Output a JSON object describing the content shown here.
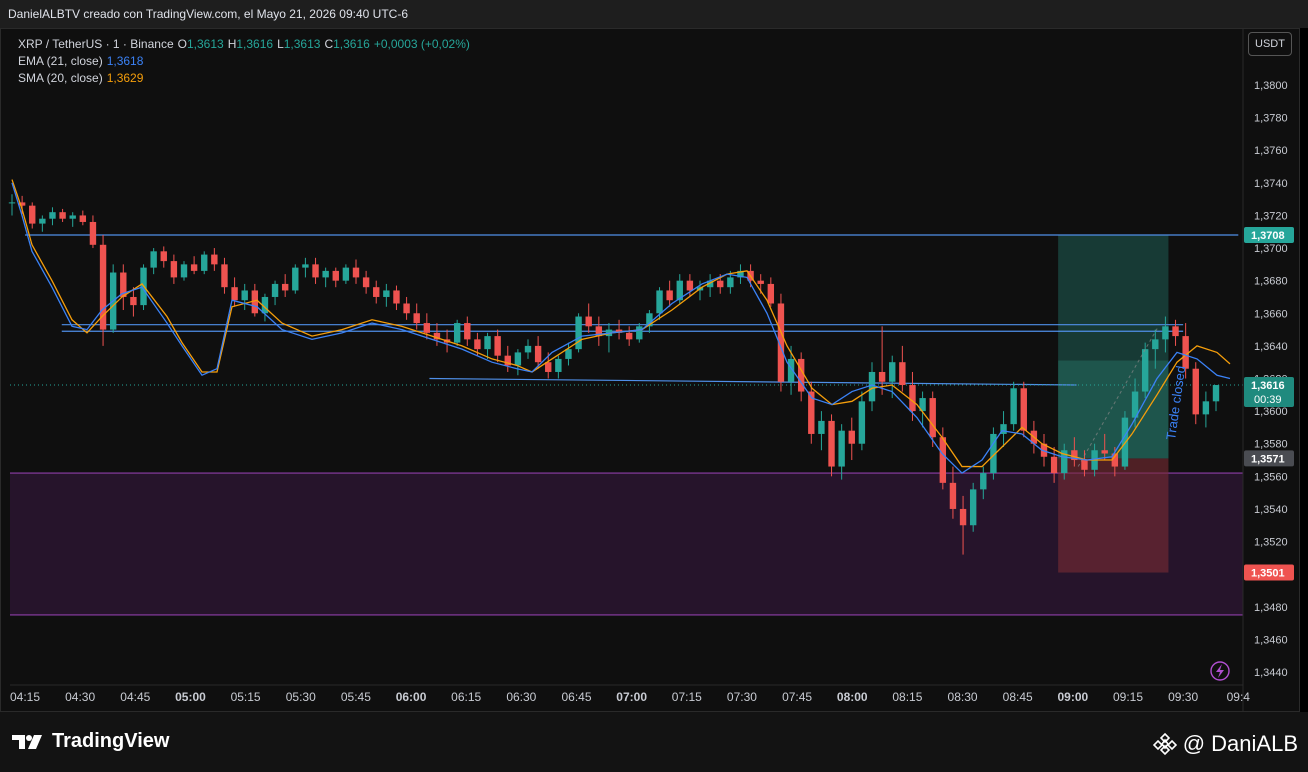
{
  "header": {
    "caption": "DanielALBTV creado con TradingView.com, el Mayo 21, 2026 09:40 UTC-6"
  },
  "legend": {
    "symbol": "XRP / TetherUS · 1 · Binance",
    "o_label": "O",
    "o_value": "1,3613",
    "h_label": "H",
    "h_value": "1,3616",
    "l_label": "L",
    "l_value": "1,3613",
    "c_label": "C",
    "c_value": "1,3616",
    "change": "+0,0003 (+0,02%)",
    "ema_label": "EMA (21, close)",
    "ema_value": "1,3618",
    "sma_label": "SMA (20, close)",
    "sma_value": "1,3629"
  },
  "currency_button": "USDT",
  "annotation": "Trade closed",
  "footer": {
    "brand": "TradingView",
    "author": "@ DaniALB"
  },
  "colors": {
    "up": "#26a69a",
    "down": "#ef5350",
    "ema": "#3b82f6",
    "sma": "#f59e0b",
    "level": "#4f8fe8",
    "zone": "#8e3ea8",
    "tp": "#1f5f55",
    "sl": "#7a2b33"
  },
  "chart_data": {
    "type": "candlestick",
    "x_ticks": [
      "04:15",
      "04:30",
      "04:45",
      "05:00",
      "05:15",
      "05:30",
      "05:45",
      "06:00",
      "06:15",
      "06:30",
      "06:45",
      "07:00",
      "07:15",
      "07:30",
      "07:45",
      "08:00",
      "08:15",
      "08:30",
      "08:45",
      "09:00",
      "09:15",
      "09:30",
      "09:4"
    ],
    "x_ticks_bold": [
      "05:00",
      "06:00",
      "07:00",
      "08:00",
      "09:00"
    ],
    "y_ticks": [
      "1,3800",
      "1,3780",
      "1,3760",
      "1,3740",
      "1,3720",
      "1,3700",
      "1,3680",
      "1,3660",
      "1,3640",
      "1,3620",
      "1,3600",
      "1,3580",
      "1,3560",
      "1,3540",
      "1,3520",
      "1,3480",
      "1,3460",
      "1,3440"
    ],
    "y_range": [
      1.3435,
      1.3825
    ],
    "price_labels": [
      {
        "text": "1,3708",
        "value": 1.3708,
        "kind": "tp"
      },
      {
        "text": "1,3616",
        "sub": "00:39",
        "value": 1.3616,
        "kind": "last"
      },
      {
        "text": "1,3571",
        "value": 1.3571,
        "kind": "entry"
      },
      {
        "text": "1,3501",
        "value": 1.3501,
        "kind": "sl"
      }
    ],
    "horizontal_levels": [
      {
        "value": 1.3708,
        "x_from": "04:15",
        "x_to": "09:4"
      },
      {
        "value": 1.3653,
        "x_from": "04:25",
        "x_to": "09:30"
      },
      {
        "value": 1.3649,
        "x_from": "04:25",
        "x_to": "09:30"
      }
    ],
    "trend_line": {
      "from": {
        "x": "06:05",
        "y": 1.362
      },
      "to": {
        "x": "09:01",
        "y": 1.3616
      }
    },
    "zone": {
      "top": 1.3562,
      "bottom": 1.3475
    },
    "position": {
      "x_from": "08:56",
      "x_to": "09:26",
      "entry": 1.3571,
      "target": 1.3708,
      "stop": 1.3501
    },
    "candles": [
      [
        1.3728,
        1.3733,
        1.372,
        1.3728
      ],
      [
        1.3728,
        1.3732,
        1.3721,
        1.3726
      ],
      [
        1.3726,
        1.3728,
        1.3712,
        1.3715
      ],
      [
        1.3715,
        1.372,
        1.371,
        1.3718
      ],
      [
        1.3718,
        1.3725,
        1.3714,
        1.3722
      ],
      [
        1.3722,
        1.3724,
        1.3716,
        1.3718
      ],
      [
        1.3718,
        1.3722,
        1.3713,
        1.372
      ],
      [
        1.372,
        1.3723,
        1.3714,
        1.3716
      ],
      [
        1.3716,
        1.372,
        1.37,
        1.3702
      ],
      [
        1.3702,
        1.3708,
        1.364,
        1.365
      ],
      [
        1.365,
        1.369,
        1.3648,
        1.3685
      ],
      [
        1.3685,
        1.369,
        1.3662,
        1.367
      ],
      [
        1.367,
        1.3676,
        1.3658,
        1.3665
      ],
      [
        1.3665,
        1.369,
        1.3662,
        1.3688
      ],
      [
        1.3688,
        1.37,
        1.3684,
        1.3698
      ],
      [
        1.3698,
        1.3701,
        1.3688,
        1.3692
      ],
      [
        1.3692,
        1.3696,
        1.3678,
        1.3682
      ],
      [
        1.3682,
        1.3692,
        1.368,
        1.369
      ],
      [
        1.369,
        1.3695,
        1.3684,
        1.3686
      ],
      [
        1.3686,
        1.3698,
        1.3684,
        1.3696
      ],
      [
        1.3696,
        1.37,
        1.3686,
        1.369
      ],
      [
        1.369,
        1.3694,
        1.3672,
        1.3676
      ],
      [
        1.3676,
        1.3682,
        1.3664,
        1.3668
      ],
      [
        1.3668,
        1.3678,
        1.3662,
        1.3674
      ],
      [
        1.3674,
        1.3678,
        1.3658,
        1.366
      ],
      [
        1.366,
        1.3672,
        1.3655,
        1.367
      ],
      [
        1.367,
        1.368,
        1.3665,
        1.3678
      ],
      [
        1.3678,
        1.3684,
        1.367,
        1.3674
      ],
      [
        1.3674,
        1.369,
        1.3672,
        1.3688
      ],
      [
        1.3688,
        1.3694,
        1.3682,
        1.369
      ],
      [
        1.369,
        1.3694,
        1.3678,
        1.3682
      ],
      [
        1.3682,
        1.3688,
        1.3676,
        1.3686
      ],
      [
        1.3686,
        1.3688,
        1.3676,
        1.368
      ],
      [
        1.368,
        1.369,
        1.3678,
        1.3688
      ],
      [
        1.3688,
        1.3693,
        1.3678,
        1.3682
      ],
      [
        1.3682,
        1.3686,
        1.3672,
        1.3676
      ],
      [
        1.3676,
        1.368,
        1.3666,
        1.367
      ],
      [
        1.367,
        1.3678,
        1.3664,
        1.3674
      ],
      [
        1.3674,
        1.3677,
        1.3662,
        1.3666
      ],
      [
        1.3666,
        1.367,
        1.3656,
        1.366
      ],
      [
        1.366,
        1.3666,
        1.365,
        1.3654
      ],
      [
        1.3654,
        1.366,
        1.3644,
        1.3648
      ],
      [
        1.3648,
        1.3654,
        1.364,
        1.3644
      ],
      [
        1.3644,
        1.365,
        1.3636,
        1.3642
      ],
      [
        1.3642,
        1.3656,
        1.364,
        1.3654
      ],
      [
        1.3654,
        1.3658,
        1.364,
        1.3644
      ],
      [
        1.3644,
        1.3648,
        1.3634,
        1.3638
      ],
      [
        1.3638,
        1.3648,
        1.3632,
        1.3646
      ],
      [
        1.3646,
        1.365,
        1.363,
        1.3634
      ],
      [
        1.3634,
        1.364,
        1.3624,
        1.3628
      ],
      [
        1.3628,
        1.3638,
        1.3622,
        1.3636
      ],
      [
        1.3636,
        1.3644,
        1.3632,
        1.364
      ],
      [
        1.364,
        1.3646,
        1.3626,
        1.363
      ],
      [
        1.363,
        1.3636,
        1.362,
        1.3624
      ],
      [
        1.3624,
        1.3634,
        1.362,
        1.3632
      ],
      [
        1.3632,
        1.3642,
        1.3628,
        1.3638
      ],
      [
        1.3638,
        1.366,
        1.3636,
        1.3658
      ],
      [
        1.3658,
        1.3666,
        1.3648,
        1.3652
      ],
      [
        1.3652,
        1.3658,
        1.364,
        1.3646
      ],
      [
        1.3646,
        1.3654,
        1.3636,
        1.365
      ],
      [
        1.365,
        1.3656,
        1.3644,
        1.3648
      ],
      [
        1.3648,
        1.3652,
        1.364,
        1.3644
      ],
      [
        1.3644,
        1.3654,
        1.3642,
        1.3652
      ],
      [
        1.3652,
        1.3662,
        1.3648,
        1.366
      ],
      [
        1.366,
        1.3676,
        1.3656,
        1.3674
      ],
      [
        1.3674,
        1.368,
        1.3664,
        1.3668
      ],
      [
        1.3668,
        1.3684,
        1.3666,
        1.368
      ],
      [
        1.368,
        1.3684,
        1.367,
        1.3674
      ],
      [
        1.3674,
        1.368,
        1.3668,
        1.3676
      ],
      [
        1.3676,
        1.3684,
        1.367,
        1.368
      ],
      [
        1.368,
        1.3684,
        1.3672,
        1.3676
      ],
      [
        1.3676,
        1.3686,
        1.3672,
        1.3682
      ],
      [
        1.3682,
        1.369,
        1.3678,
        1.3686
      ],
      [
        1.3686,
        1.369,
        1.3676,
        1.368
      ],
      [
        1.368,
        1.3684,
        1.3672,
        1.3678
      ],
      [
        1.3678,
        1.3682,
        1.3664,
        1.3666
      ],
      [
        1.3666,
        1.3672,
        1.3612,
        1.3618
      ],
      [
        1.3618,
        1.364,
        1.361,
        1.3632
      ],
      [
        1.3632,
        1.3636,
        1.3606,
        1.3612
      ],
      [
        1.3612,
        1.3618,
        1.358,
        1.3586
      ],
      [
        1.3586,
        1.36,
        1.3576,
        1.3594
      ],
      [
        1.3594,
        1.3598,
        1.356,
        1.3566
      ],
      [
        1.3566,
        1.3592,
        1.3558,
        1.3588
      ],
      [
        1.3588,
        1.3596,
        1.357,
        1.358
      ],
      [
        1.358,
        1.3612,
        1.3576,
        1.3606
      ],
      [
        1.3606,
        1.363,
        1.36,
        1.3624
      ],
      [
        1.3624,
        1.3652,
        1.361,
        1.3618
      ],
      [
        1.3618,
        1.3634,
        1.3608,
        1.363
      ],
      [
        1.363,
        1.364,
        1.3612,
        1.3616
      ],
      [
        1.3616,
        1.3624,
        1.3594,
        1.36
      ],
      [
        1.36,
        1.3612,
        1.359,
        1.3608
      ],
      [
        1.3608,
        1.3612,
        1.3578,
        1.3584
      ],
      [
        1.3584,
        1.359,
        1.3552,
        1.3556
      ],
      [
        1.3556,
        1.3566,
        1.3534,
        1.354
      ],
      [
        1.354,
        1.3548,
        1.3512,
        1.353
      ],
      [
        1.353,
        1.3556,
        1.3526,
        1.3552
      ],
      [
        1.3552,
        1.3566,
        1.3546,
        1.3562
      ],
      [
        1.3562,
        1.359,
        1.3558,
        1.3586
      ],
      [
        1.3586,
        1.36,
        1.3578,
        1.3592
      ],
      [
        1.3592,
        1.3618,
        1.3588,
        1.3614
      ],
      [
        1.3614,
        1.3618,
        1.3584,
        1.3588
      ],
      [
        1.3588,
        1.3594,
        1.3574,
        1.358
      ],
      [
        1.358,
        1.3586,
        1.3566,
        1.3572
      ],
      [
        1.3572,
        1.3578,
        1.3556,
        1.3562
      ],
      [
        1.3562,
        1.358,
        1.3558,
        1.3576
      ],
      [
        1.3576,
        1.3584,
        1.3566,
        1.357
      ],
      [
        1.357,
        1.3576,
        1.356,
        1.3564
      ],
      [
        1.3564,
        1.358,
        1.356,
        1.3576
      ],
      [
        1.3576,
        1.3586,
        1.357,
        1.3574
      ],
      [
        1.3574,
        1.3578,
        1.356,
        1.3566
      ],
      [
        1.3566,
        1.36,
        1.3564,
        1.3596
      ],
      [
        1.3596,
        1.362,
        1.359,
        1.3612
      ],
      [
        1.3612,
        1.3642,
        1.3608,
        1.3638
      ],
      [
        1.3638,
        1.365,
        1.3626,
        1.3644
      ],
      [
        1.3644,
        1.3658,
        1.3636,
        1.3652
      ],
      [
        1.3652,
        1.3656,
        1.364,
        1.3646
      ],
      [
        1.3646,
        1.3654,
        1.362,
        1.3626
      ],
      [
        1.3626,
        1.363,
        1.3592,
        1.3598
      ],
      [
        1.3598,
        1.3612,
        1.359,
        1.3606
      ],
      [
        1.3606,
        1.3616,
        1.36,
        1.3616
      ]
    ],
    "ema_21": [
      [
        0,
        1.374
      ],
      [
        10,
        1.372
      ],
      [
        20,
        1.3698
      ],
      [
        40,
        1.3676
      ],
      [
        60,
        1.3652
      ],
      [
        75,
        1.365
      ],
      [
        90,
        1.3662
      ],
      [
        110,
        1.3672
      ],
      [
        130,
        1.3676
      ],
      [
        155,
        1.3654
      ],
      [
        170,
        1.364
      ],
      [
        190,
        1.3622
      ],
      [
        205,
        1.3626
      ],
      [
        220,
        1.3668
      ],
      [
        245,
        1.3664
      ],
      [
        270,
        1.365
      ],
      [
        300,
        1.3644
      ],
      [
        330,
        1.3648
      ],
      [
        360,
        1.3654
      ],
      [
        390,
        1.365
      ],
      [
        420,
        1.3644
      ],
      [
        450,
        1.3638
      ],
      [
        480,
        1.363
      ],
      [
        505,
        1.3626
      ],
      [
        520,
        1.3624
      ],
      [
        540,
        1.3636
      ],
      [
        570,
        1.3646
      ],
      [
        600,
        1.3648
      ],
      [
        630,
        1.365
      ],
      [
        660,
        1.3666
      ],
      [
        690,
        1.3678
      ],
      [
        715,
        1.3684
      ],
      [
        735,
        1.3682
      ],
      [
        755,
        1.366
      ],
      [
        775,
        1.363
      ],
      [
        800,
        1.3608
      ],
      [
        820,
        1.3604
      ],
      [
        840,
        1.3612
      ],
      [
        860,
        1.3616
      ],
      [
        880,
        1.3612
      ],
      [
        905,
        1.3596
      ],
      [
        930,
        1.3574
      ],
      [
        950,
        1.3562
      ],
      [
        970,
        1.357
      ],
      [
        990,
        1.3588
      ],
      [
        1010,
        1.3586
      ],
      [
        1030,
        1.3576
      ],
      [
        1050,
        1.3572
      ],
      [
        1075,
        1.357
      ],
      [
        1100,
        1.3572
      ],
      [
        1120,
        1.3592
      ],
      [
        1145,
        1.362
      ],
      [
        1165,
        1.3636
      ],
      [
        1185,
        1.3632
      ],
      [
        1205,
        1.3622
      ],
      [
        1218,
        1.362
      ]
    ],
    "sma_20": [
      [
        0,
        1.3742
      ],
      [
        10,
        1.3724
      ],
      [
        20,
        1.3702
      ],
      [
        40,
        1.368
      ],
      [
        60,
        1.3656
      ],
      [
        75,
        1.3648
      ],
      [
        90,
        1.3658
      ],
      [
        110,
        1.367
      ],
      [
        130,
        1.3678
      ],
      [
        155,
        1.3658
      ],
      [
        170,
        1.3642
      ],
      [
        190,
        1.3624
      ],
      [
        205,
        1.3624
      ],
      [
        220,
        1.3664
      ],
      [
        245,
        1.3668
      ],
      [
        270,
        1.3654
      ],
      [
        300,
        1.3646
      ],
      [
        330,
        1.365
      ],
      [
        360,
        1.3656
      ],
      [
        390,
        1.3652
      ],
      [
        420,
        1.3646
      ],
      [
        450,
        1.364
      ],
      [
        480,
        1.3632
      ],
      [
        505,
        1.3628
      ],
      [
        520,
        1.3624
      ],
      [
        540,
        1.3632
      ],
      [
        570,
        1.3644
      ],
      [
        600,
        1.3648
      ],
      [
        630,
        1.365
      ],
      [
        660,
        1.3662
      ],
      [
        690,
        1.3676
      ],
      [
        715,
        1.3684
      ],
      [
        735,
        1.3686
      ],
      [
        755,
        1.3668
      ],
      [
        775,
        1.364
      ],
      [
        800,
        1.3614
      ],
      [
        820,
        1.3604
      ],
      [
        840,
        1.3606
      ],
      [
        860,
        1.3614
      ],
      [
        880,
        1.3616
      ],
      [
        905,
        1.3604
      ],
      [
        930,
        1.3584
      ],
      [
        950,
        1.3566
      ],
      [
        970,
        1.3566
      ],
      [
        990,
        1.3578
      ],
      [
        1010,
        1.359
      ],
      [
        1030,
        1.358
      ],
      [
        1050,
        1.3574
      ],
      [
        1075,
        1.357
      ],
      [
        1100,
        1.357
      ],
      [
        1120,
        1.3586
      ],
      [
        1145,
        1.361
      ],
      [
        1165,
        1.363
      ],
      [
        1185,
        1.364
      ],
      [
        1205,
        1.3636
      ],
      [
        1218,
        1.3629
      ]
    ]
  }
}
